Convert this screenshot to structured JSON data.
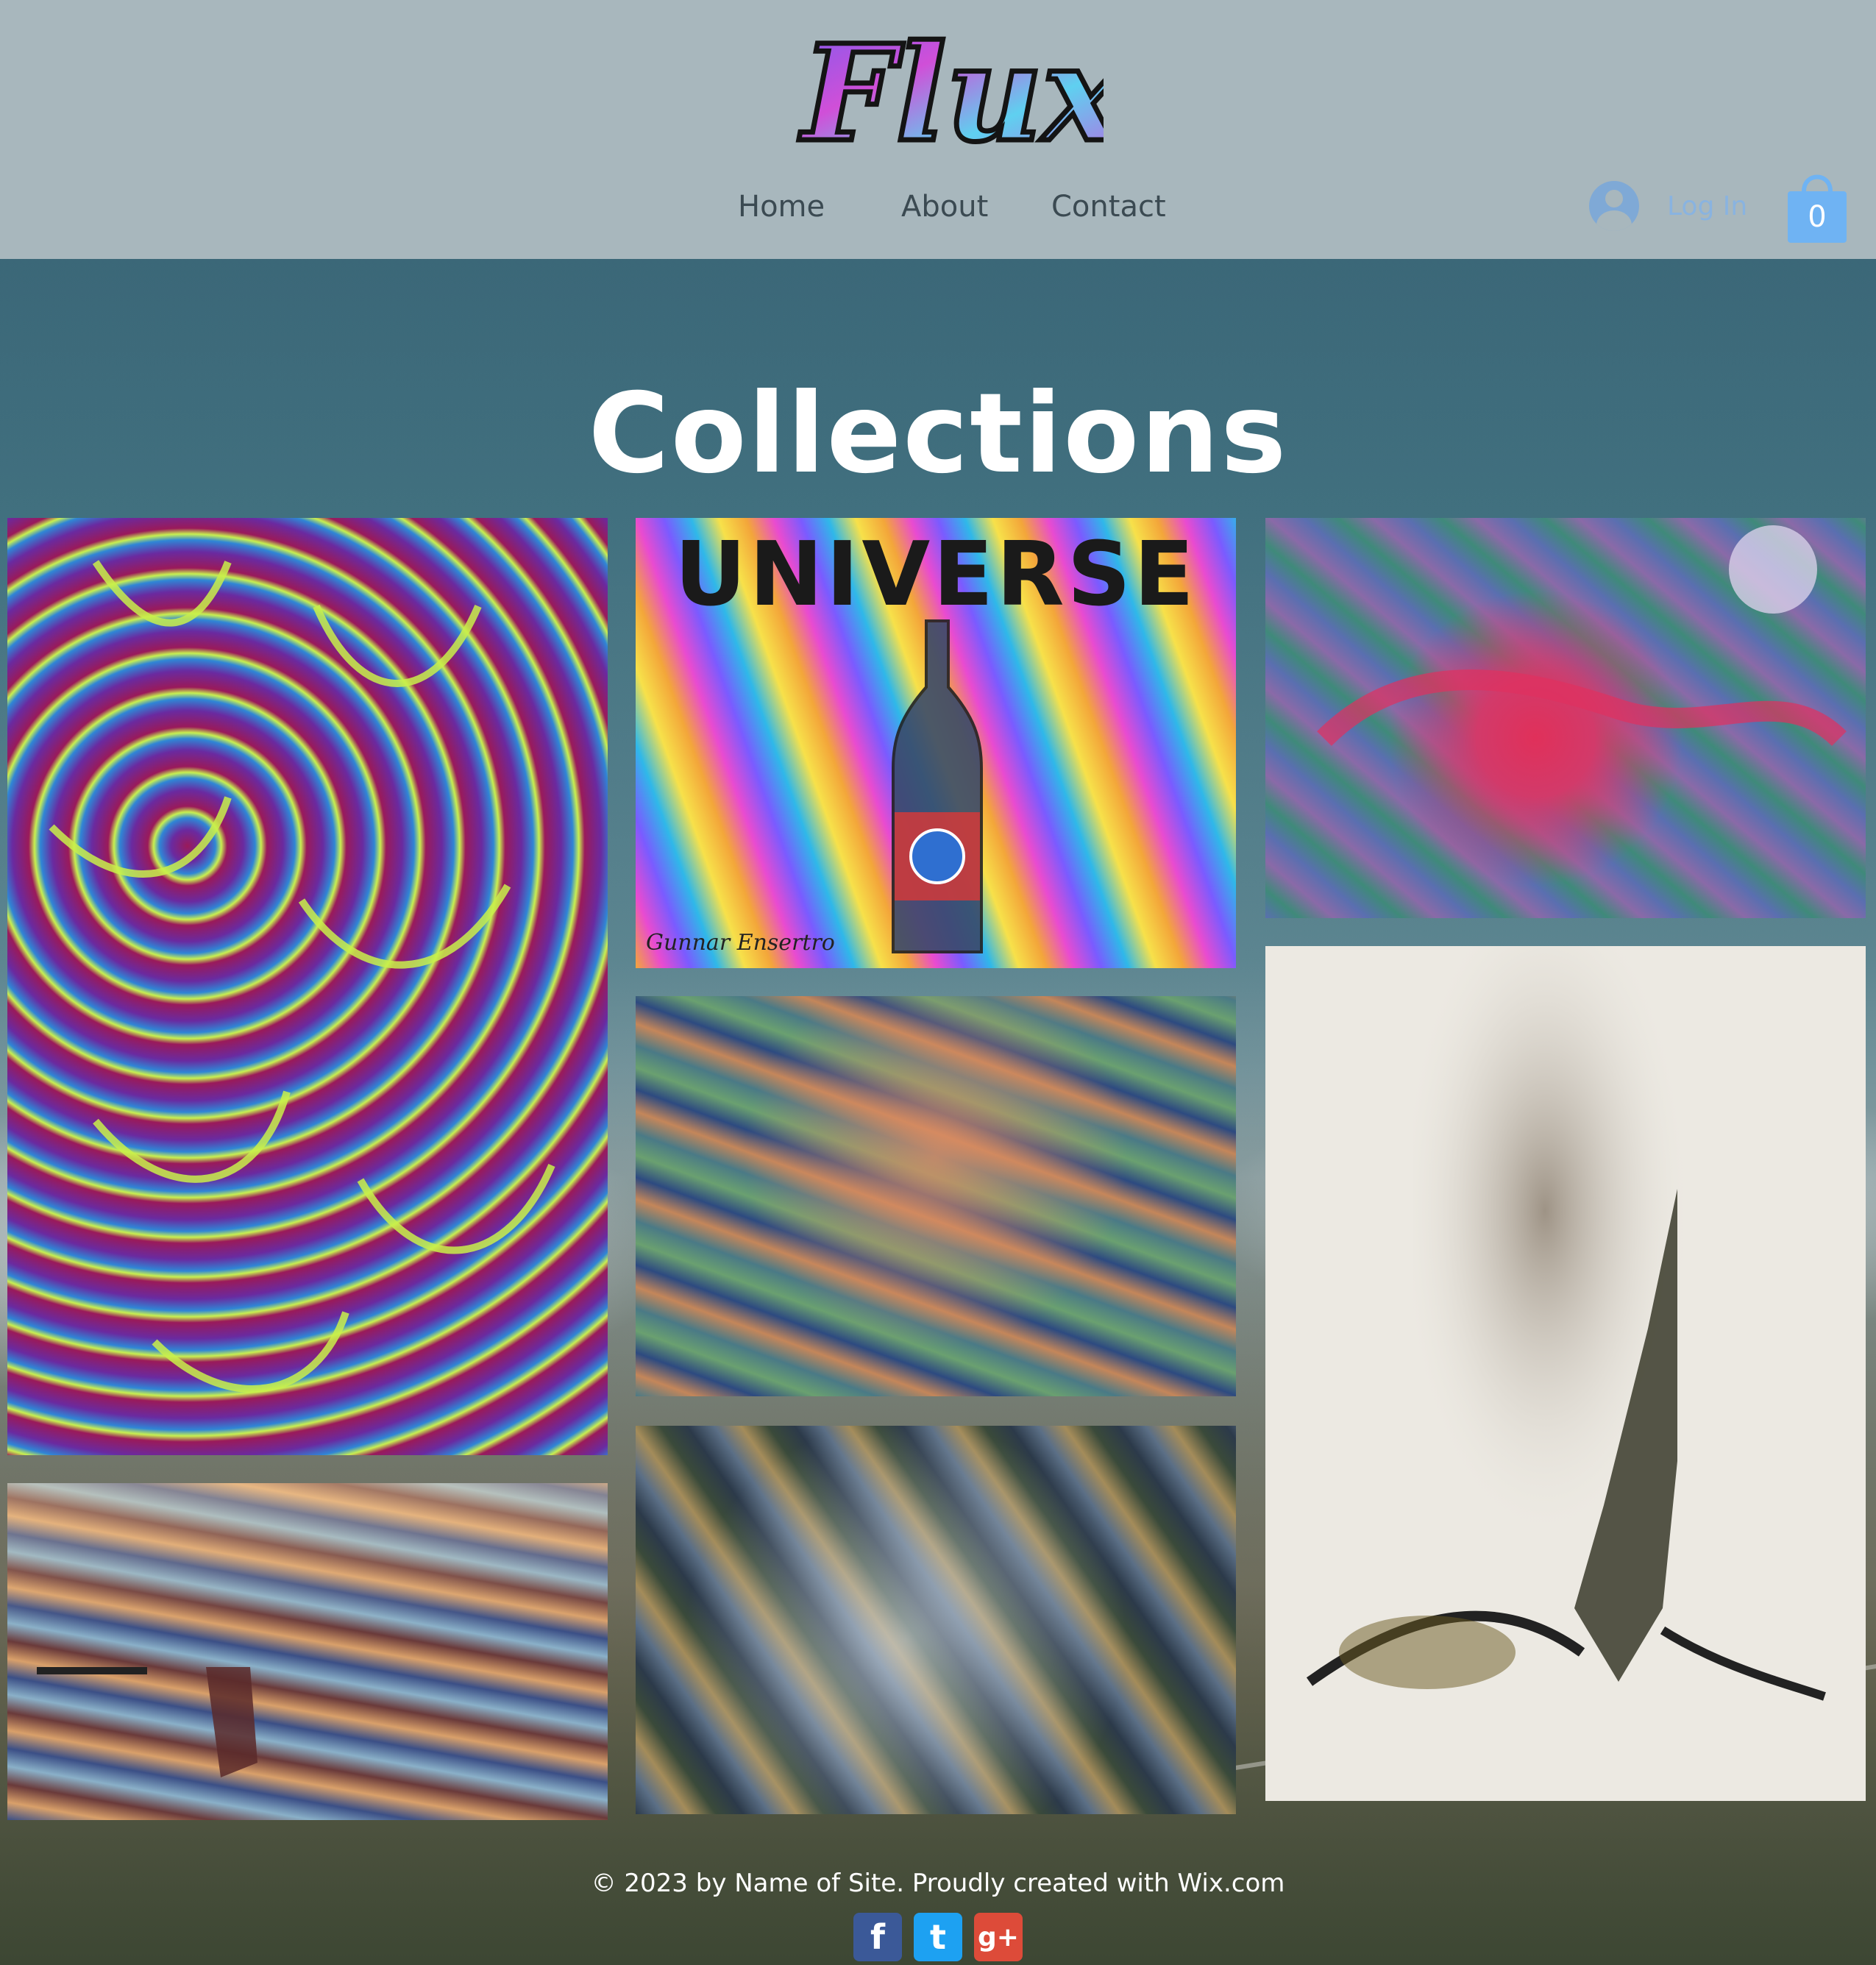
{
  "header": {
    "logo_text": "Flux",
    "nav": [
      "Home",
      "About",
      "Contact"
    ],
    "login_label": "Log In",
    "cart_count": "0"
  },
  "main": {
    "title": "Collections",
    "gallery": [
      {
        "name": "flower-petals-artwork"
      },
      {
        "name": "universe-bottle-artwork",
        "title_text": "UNIVERSE",
        "signature": "Gunnar Ensertro"
      },
      {
        "name": "psychedelic-abstract-artwork"
      },
      {
        "name": "forest-abstract-artwork"
      },
      {
        "name": "ink-splatter-figure-artwork"
      },
      {
        "name": "landscape-chair-artwork"
      },
      {
        "name": "city-abstract-artwork"
      }
    ]
  },
  "footer": {
    "copyright": "© 2023 by Name of Site. Proudly created with Wix.com",
    "social": [
      {
        "icon": "facebook-icon",
        "glyph": "f",
        "color": "#3b5998"
      },
      {
        "icon": "twitter-icon",
        "glyph": "t",
        "color": "#1da1f2"
      },
      {
        "icon": "google-plus-icon",
        "glyph": "g+",
        "color": "#dd4b39"
      }
    ]
  },
  "colors": {
    "header_bg": "#a8b7bd",
    "accent_blue": "#7fa9d6",
    "cart_blue": "#6fb3f3"
  }
}
